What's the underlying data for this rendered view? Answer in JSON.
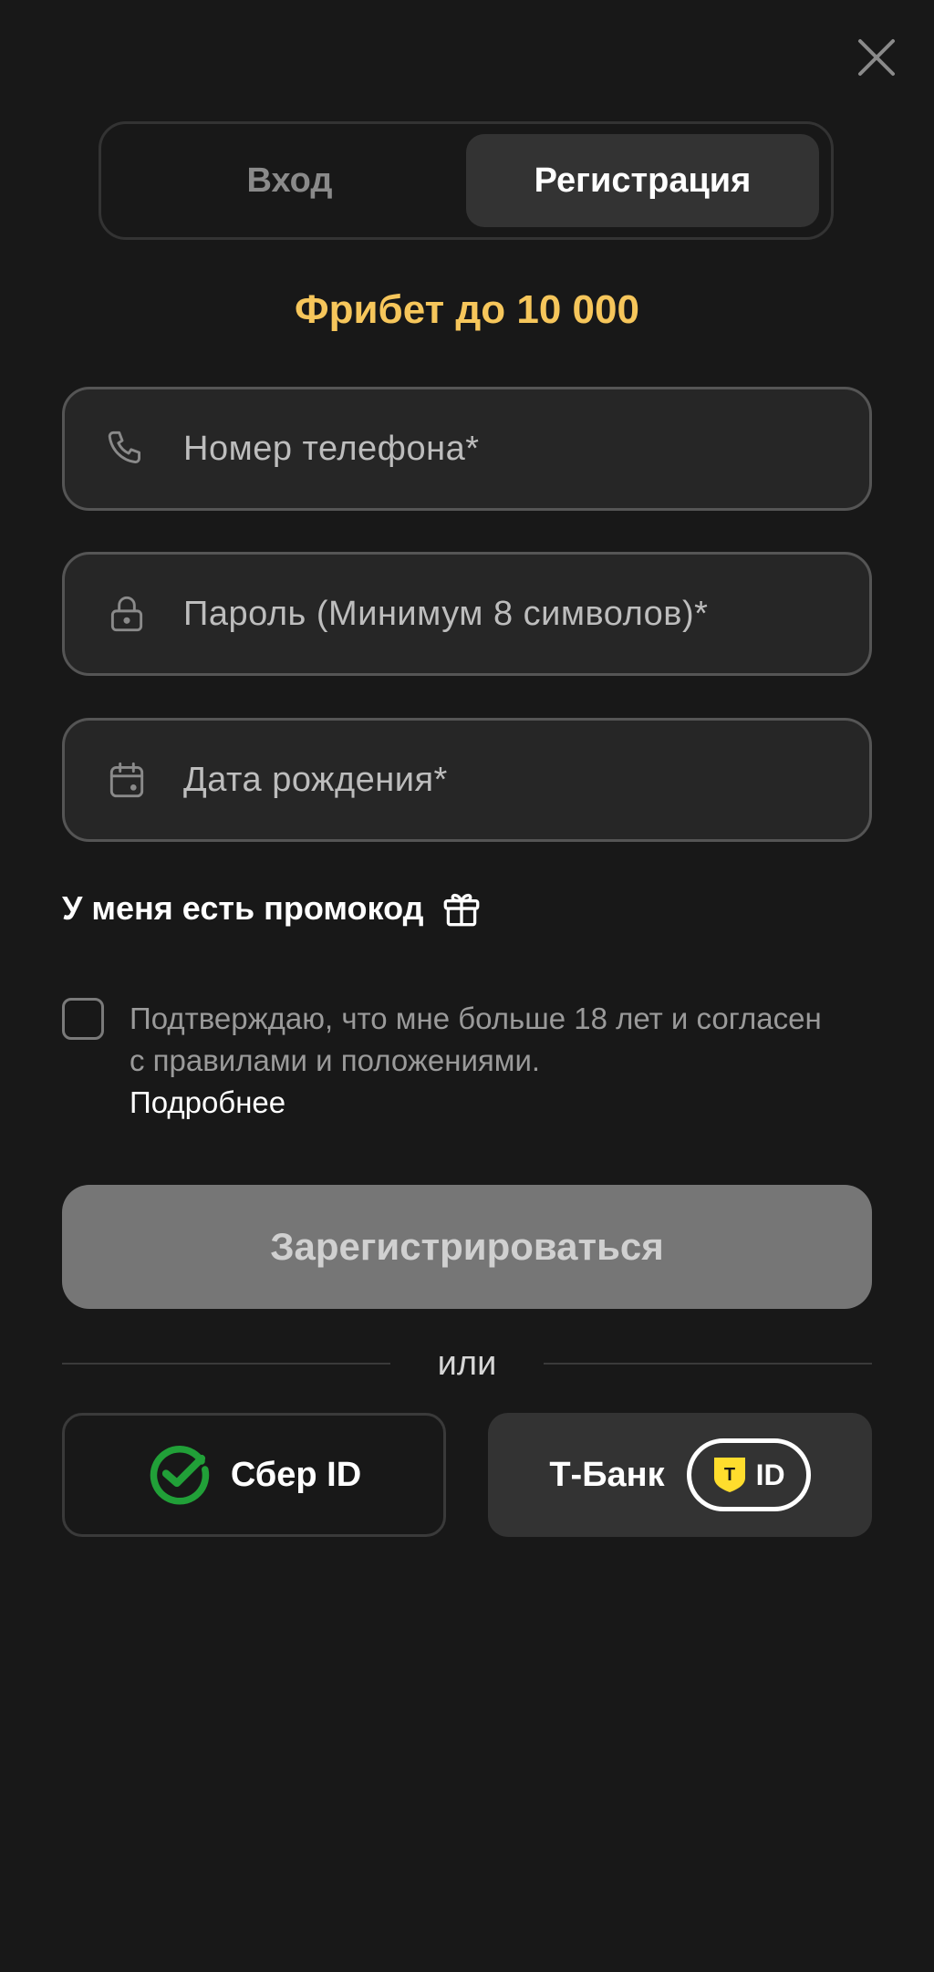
{
  "tabs": [
    {
      "label": "Вход",
      "active": false
    },
    {
      "label": "Регистрация",
      "active": true
    }
  ],
  "bonus": "Фрибет до 10 000",
  "fields": {
    "phone": {
      "placeholder": "Номер телефона*",
      "icon": "phone-icon"
    },
    "password": {
      "placeholder": "Пароль (Минимум 8 символов)*",
      "icon": "lock-icon"
    },
    "birthdate": {
      "placeholder": "Дата рождения*",
      "icon": "calendar-icon"
    }
  },
  "promo": {
    "label": "У меня есть промокод",
    "icon": "gift-icon"
  },
  "consent": {
    "text": "Подтверждаю, что мне больше 18 лет и согласен с правилами и положениями.",
    "link": "Подробнее",
    "checked": false
  },
  "submit_label": "Зарегистрироваться",
  "divider_label": "или",
  "social": {
    "sber_label": "Сбер ID",
    "tbank_label": "Т-Банк",
    "tbank_badge_mark": "T",
    "tbank_badge_text": "ID"
  },
  "colors": {
    "background": "#181818",
    "accent": "#f6c65b",
    "sber_green": "#21a038",
    "tbank_yellow": "#ffdd2d"
  }
}
